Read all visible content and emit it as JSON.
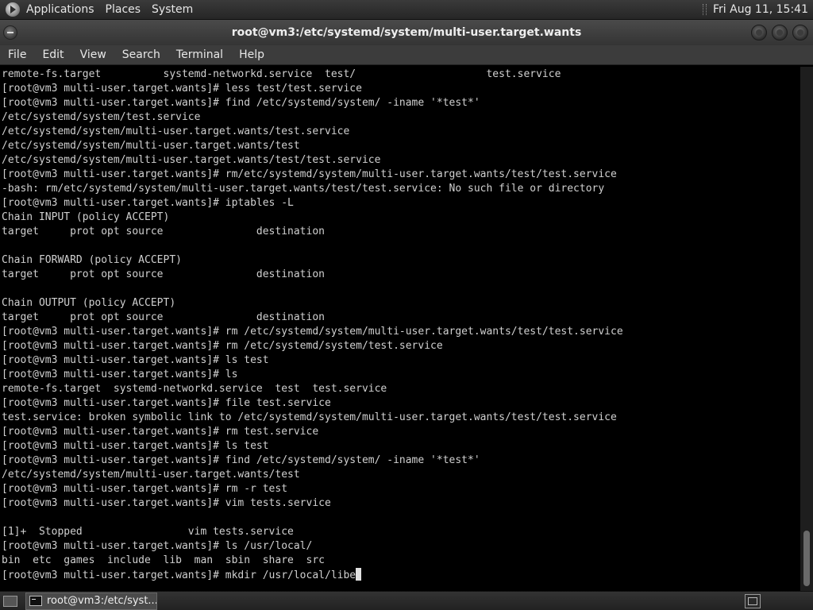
{
  "top_panel": {
    "menus": [
      "Applications",
      "Places",
      "System"
    ],
    "icon": "gnome-foot-icon",
    "clock": "Fri Aug 11, 15:41"
  },
  "window": {
    "title": "root@vm3:/etc/systemd/system/multi-user.target.wants",
    "menubar": [
      "File",
      "Edit",
      "View",
      "Search",
      "Terminal",
      "Help"
    ]
  },
  "terminal": {
    "lines": [
      "remote-fs.target          systemd-networkd.service  test/                     test.service",
      "[root@vm3 multi-user.target.wants]# less test/test.service",
      "[root@vm3 multi-user.target.wants]# find /etc/systemd/system/ -iname '*test*'",
      "/etc/systemd/system/test.service",
      "/etc/systemd/system/multi-user.target.wants/test.service",
      "/etc/systemd/system/multi-user.target.wants/test",
      "/etc/systemd/system/multi-user.target.wants/test/test.service",
      "[root@vm3 multi-user.target.wants]# rm/etc/systemd/system/multi-user.target.wants/test/test.service",
      "-bash: rm/etc/systemd/system/multi-user.target.wants/test/test.service: No such file or directory",
      "[root@vm3 multi-user.target.wants]# iptables -L",
      "Chain INPUT (policy ACCEPT)",
      "target     prot opt source               destination",
      "",
      "Chain FORWARD (policy ACCEPT)",
      "target     prot opt source               destination",
      "",
      "Chain OUTPUT (policy ACCEPT)",
      "target     prot opt source               destination",
      "[root@vm3 multi-user.target.wants]# rm /etc/systemd/system/multi-user.target.wants/test/test.service",
      "[root@vm3 multi-user.target.wants]# rm /etc/systemd/system/test.service",
      "[root@vm3 multi-user.target.wants]# ls test",
      "[root@vm3 multi-user.target.wants]# ls",
      "remote-fs.target  systemd-networkd.service  test  test.service",
      "[root@vm3 multi-user.target.wants]# file test.service",
      "test.service: broken symbolic link to /etc/systemd/system/multi-user.target.wants/test/test.service",
      "[root@vm3 multi-user.target.wants]# rm test.service",
      "[root@vm3 multi-user.target.wants]# ls test",
      "[root@vm3 multi-user.target.wants]# find /etc/systemd/system/ -iname '*test*'",
      "/etc/systemd/system/multi-user.target.wants/test",
      "[root@vm3 multi-user.target.wants]# rm -r test",
      "[root@vm3 multi-user.target.wants]# vim tests.service",
      "",
      "[1]+  Stopped                 vim tests.service",
      "[root@vm3 multi-user.target.wants]# ls /usr/local/",
      "bin  etc  games  include  lib  man  sbin  share  src",
      "[root@vm3 multi-user.target.wants]# mkdir /usr/local/libe"
    ]
  },
  "taskbar": {
    "task_label": "root@vm3:/etc/syst..."
  },
  "colors": {
    "terminal_bg": "#000000",
    "terminal_fg": "#d0d0d0",
    "panel_bg": "#2e2e2e"
  }
}
